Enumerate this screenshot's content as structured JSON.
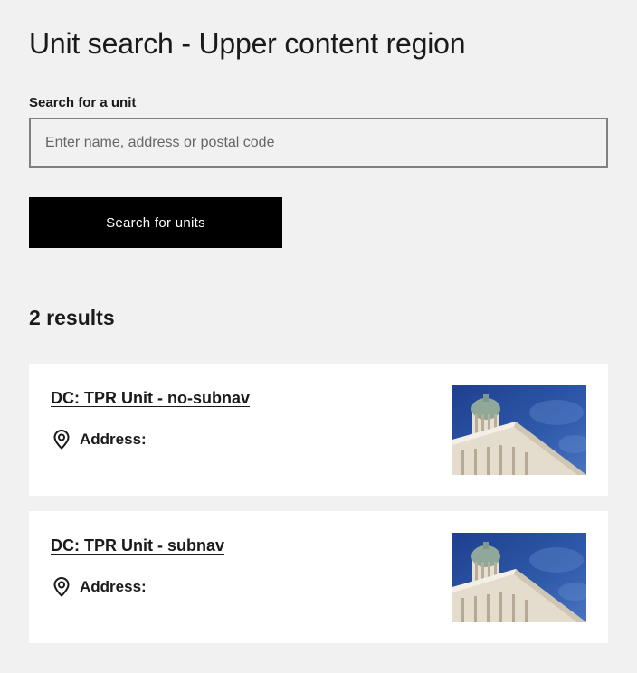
{
  "page": {
    "title": "Unit search - Upper content region"
  },
  "search": {
    "label": "Search for a unit",
    "placeholder": "Enter name, address or postal code",
    "value": "",
    "button_label": "Search for units"
  },
  "results": {
    "count_label": "2 results",
    "items": [
      {
        "title": "DC: TPR Unit - no-subnav",
        "address_label": "Address:",
        "icon": "location-pin-icon"
      },
      {
        "title": "DC: TPR Unit - subnav",
        "address_label": "Address:",
        "icon": "location-pin-icon"
      }
    ]
  },
  "colors": {
    "background": "#f1f1f1",
    "card": "#ffffff",
    "button": "#000000",
    "button_text": "#ffffff",
    "input_border": "#808080",
    "text": "#1a1a1a"
  }
}
